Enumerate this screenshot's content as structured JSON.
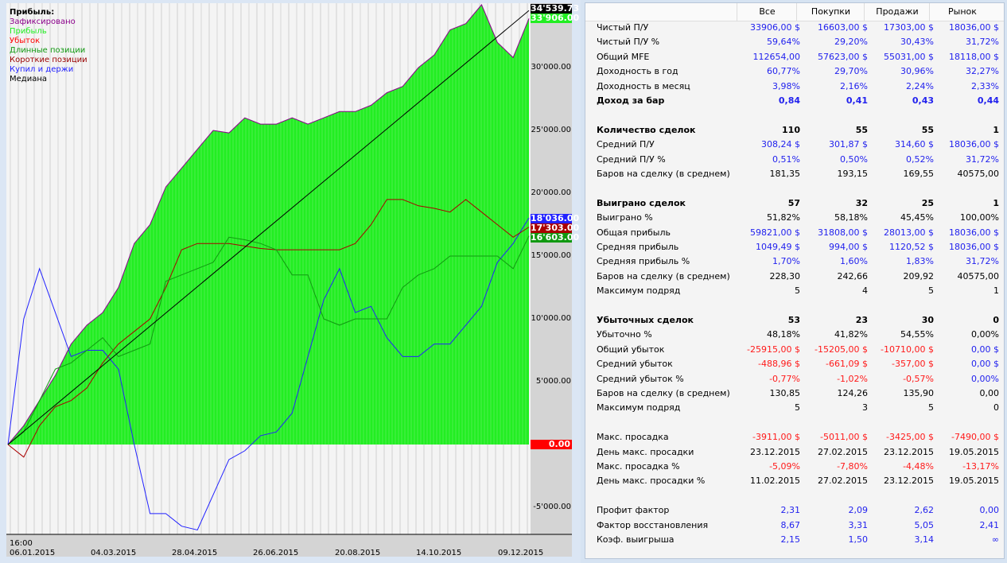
{
  "legend": {
    "title": "Прибыль:",
    "items": [
      {
        "label": "Зафиксировано",
        "color": "#8b008b"
      },
      {
        "label": "Прибыль",
        "color": "#22ee22"
      },
      {
        "label": "Убыток",
        "color": "#ff0000"
      },
      {
        "label": "Длинные позиции",
        "color": "#119911"
      },
      {
        "label": "Короткие позиции",
        "color": "#990000"
      },
      {
        "label": "Купил и держи",
        "color": "#2222ff"
      },
      {
        "label": "Медиана",
        "color": "#000000"
      }
    ]
  },
  "y_axis": [
    "30'000.00",
    "25'000.00",
    "20'000.00",
    "15'000.00",
    "10'000.00",
    "5'000.00",
    "0.00",
    "-5'000.00"
  ],
  "x_axis": {
    "time": "16:00",
    "dates": [
      "06.01.2015",
      "04.03.2015",
      "28.04.2015",
      "26.06.2015",
      "20.08.2015",
      "14.10.2015",
      "09.12.2015"
    ]
  },
  "value_labels": {
    "median": "34'539.73",
    "profit": "33'906.00",
    "buyhold": "18'036.00",
    "shorts": "17'303.00",
    "longs": "16'603.00",
    "zero": "0.00"
  },
  "chart_data": {
    "type": "line",
    "ylim": [
      -7500,
      36000
    ],
    "series": [
      {
        "name": "Прибыль",
        "color": "#22ee22",
        "values": [
          0,
          1500,
          3500,
          5500,
          8000,
          9500,
          10500,
          12500,
          16000,
          17500,
          20500,
          22000,
          23500,
          25000,
          24800,
          26000,
          25500,
          25500,
          26000,
          25500,
          26000,
          26500,
          26500,
          27000,
          28000,
          28500,
          30000,
          31000,
          33000,
          33500,
          35000,
          32000,
          30800,
          33906
        ]
      },
      {
        "name": "Купил и держи",
        "color": "#2222ff",
        "values": [
          0,
          10000,
          14000,
          10500,
          7000,
          7500,
          7500,
          6000,
          0,
          -5500,
          -5500,
          -6500,
          -6800,
          -4000,
          -1200,
          -500,
          700,
          1000,
          2500,
          7000,
          11500,
          14000,
          10500,
          11000,
          8500,
          7000,
          7000,
          8000,
          8000,
          9500,
          11000,
          14500,
          16000,
          18036
        ]
      },
      {
        "name": "Короткие позиции",
        "color": "#aa0000",
        "values": [
          0,
          -1000,
          1500,
          3000,
          3500,
          4500,
          6500,
          8000,
          9000,
          10000,
          12500,
          15500,
          16000,
          16000,
          16000,
          15800,
          15600,
          15500,
          15500,
          15500,
          15500,
          15500,
          16000,
          17500,
          19500,
          19500,
          19000,
          18800,
          18500,
          19500,
          18500,
          17500,
          16500,
          17303
        ]
      },
      {
        "name": "Длинные позиции",
        "color": "#119911",
        "values": [
          0,
          1000,
          3500,
          6000,
          6500,
          7500,
          8500,
          7000,
          7500,
          8000,
          13000,
          13500,
          14000,
          14500,
          16500,
          16300,
          16000,
          15500,
          13500,
          13500,
          10000,
          9500,
          10000,
          10000,
          10000,
          12500,
          13500,
          14000,
          15000,
          15000,
          15000,
          15000,
          14000,
          16603
        ]
      },
      {
        "name": "Медиана",
        "color": "#000000",
        "values": [
          0,
          34539.73
        ]
      }
    ]
  },
  "table": {
    "columns": [
      "",
      "Все",
      "Покупки",
      "Продажи",
      "Рынок"
    ],
    "rows": [
      {
        "label": "Чистый П/У",
        "v": [
          "33906,00 $",
          "16603,00 $",
          "17303,00 $",
          "18036,00 $"
        ],
        "c": "bbbb"
      },
      {
        "label": "Чистый П/У %",
        "v": [
          "59,64%",
          "29,20%",
          "30,43%",
          "31,72%"
        ],
        "c": "bbbb"
      },
      {
        "label": "Общий MFE",
        "v": [
          "112654,00",
          "57623,00 $",
          "55031,00 $",
          "18118,00 $"
        ],
        "c": "bbbb"
      },
      {
        "label": "Доходность в год",
        "v": [
          "60,77%",
          "29,70%",
          "30,96%",
          "32,27%"
        ],
        "c": "bbbb"
      },
      {
        "label": "Доходность в месяц",
        "v": [
          "3,98%",
          "2,16%",
          "2,24%",
          "2,33%"
        ],
        "c": "bbbb"
      },
      {
        "label": "Доход за бар",
        "v": [
          "0,84",
          "0,41",
          "0,43",
          "0,44"
        ],
        "c": "bbbb",
        "bold": true
      },
      null,
      {
        "label": "Количество сделок",
        "v": [
          "110",
          "55",
          "55",
          "1"
        ],
        "c": "kkkk",
        "bold": true
      },
      {
        "label": "Средний П/У",
        "v": [
          "308,24 $",
          "301,87 $",
          "314,60 $",
          "18036,00 $"
        ],
        "c": "bbbb"
      },
      {
        "label": "Средний П/У %",
        "v": [
          "0,51%",
          "0,50%",
          "0,52%",
          "31,72%"
        ],
        "c": "bbbb"
      },
      {
        "label": "Баров на сделку (в среднем)",
        "v": [
          "181,35",
          "193,15",
          "169,55",
          "40575,00"
        ],
        "c": "kkkk"
      },
      null,
      {
        "label": "Выиграно сделок",
        "v": [
          "57",
          "32",
          "25",
          "1"
        ],
        "c": "kkkk",
        "bold": true
      },
      {
        "label": "Выиграно %",
        "v": [
          "51,82%",
          "58,18%",
          "45,45%",
          "100,00%"
        ],
        "c": "kkkk"
      },
      {
        "label": "Общая прибыль",
        "v": [
          "59821,00 $",
          "31808,00 $",
          "28013,00 $",
          "18036,00 $"
        ],
        "c": "bbbb"
      },
      {
        "label": "Средняя прибыль",
        "v": [
          "1049,49 $",
          "994,00 $",
          "1120,52 $",
          "18036,00 $"
        ],
        "c": "bbbb"
      },
      {
        "label": "Средняя прибыль %",
        "v": [
          "1,70%",
          "1,60%",
          "1,83%",
          "31,72%"
        ],
        "c": "bbbb"
      },
      {
        "label": "Баров на сделку (в среднем)",
        "v": [
          "228,30",
          "242,66",
          "209,92",
          "40575,00"
        ],
        "c": "kkkk"
      },
      {
        "label": "Максимум подряд",
        "v": [
          "5",
          "4",
          "5",
          "1"
        ],
        "c": "kkkk"
      },
      null,
      {
        "label": "Убыточных сделок",
        "v": [
          "53",
          "23",
          "30",
          "0"
        ],
        "c": "kkkk",
        "bold": true
      },
      {
        "label": "Убыточно %",
        "v": [
          "48,18%",
          "41,82%",
          "54,55%",
          "0,00%"
        ],
        "c": "kkkk"
      },
      {
        "label": "Общий убыток",
        "v": [
          "-25915,00 $",
          "-15205,00 $",
          "-10710,00 $",
          "0,00 $"
        ],
        "c": "rrrb"
      },
      {
        "label": "Средний убыток",
        "v": [
          "-488,96 $",
          "-661,09 $",
          "-357,00 $",
          "0,00 $"
        ],
        "c": "rrrb"
      },
      {
        "label": "Средний убыток %",
        "v": [
          "-0,77%",
          "-1,02%",
          "-0,57%",
          "0,00%"
        ],
        "c": "rrrb"
      },
      {
        "label": "Баров на сделку (в среднем)",
        "v": [
          "130,85",
          "124,26",
          "135,90",
          "0,00"
        ],
        "c": "kkkk"
      },
      {
        "label": "Максимум подряд",
        "v": [
          "5",
          "3",
          "5",
          "0"
        ],
        "c": "kkkk"
      },
      null,
      {
        "label": "Макс. просадка",
        "v": [
          "-3911,00 $",
          "-5011,00 $",
          "-3425,00 $",
          "-7490,00 $"
        ],
        "c": "rrrr"
      },
      {
        "label": "День макс. просадки",
        "v": [
          "23.12.2015",
          "27.02.2015",
          "23.12.2015",
          "19.05.2015"
        ],
        "c": "kkkk"
      },
      {
        "label": "Макс. просадка %",
        "v": [
          "-5,09%",
          "-7,80%",
          "-4,48%",
          "-13,17%"
        ],
        "c": "rrrr"
      },
      {
        "label": "День макс. просадки %",
        "v": [
          "11.02.2015",
          "27.02.2015",
          "23.12.2015",
          "19.05.2015"
        ],
        "c": "kkkk"
      },
      null,
      {
        "label": "Профит фактор",
        "v": [
          "2,31",
          "2,09",
          "2,62",
          "0,00"
        ],
        "c": "bbbb"
      },
      {
        "label": "Фактор восстановления",
        "v": [
          "8,67",
          "3,31",
          "5,05",
          "2,41"
        ],
        "c": "bbbb"
      },
      {
        "label": "Коэф. выигрыша",
        "v": [
          "2,15",
          "1,50",
          "3,14",
          "∞"
        ],
        "c": "bbbb"
      }
    ]
  }
}
